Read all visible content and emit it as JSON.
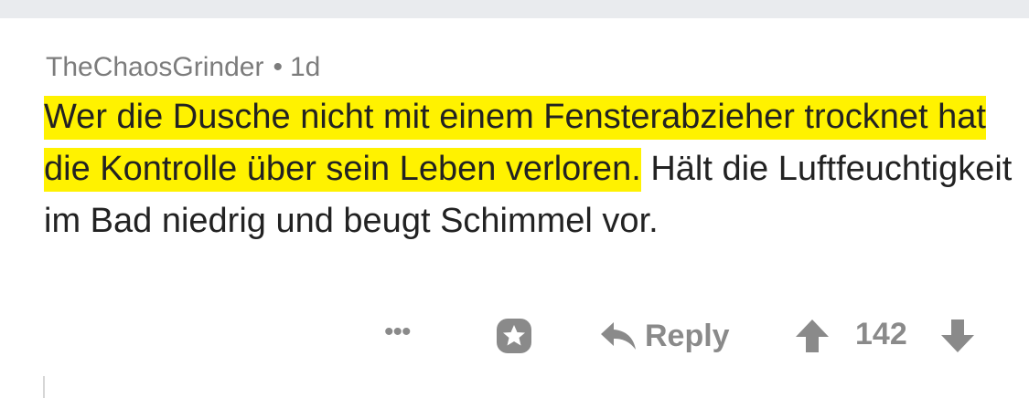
{
  "comment": {
    "author": "TheChaosGrinder",
    "separator": "•",
    "age": "1d",
    "highlighted_text": "Wer die Dusche nicht mit einem Fensterabzieher trocknet hat die Kontrolle über sein Leben verloren.",
    "rest_text": " Hält die Luftfeuchtigkeit im Bad niedrig und beugt Schimmel vor.",
    "highlight_color": "#fff200"
  },
  "actions": {
    "more_label": "•••",
    "award_icon": "award-icon",
    "reply_icon": "reply-arrow-icon",
    "reply_label": "Reply",
    "upvote_icon": "upvote-arrow-icon",
    "score": "142",
    "downvote_icon": "downvote-arrow-icon"
  },
  "colors": {
    "muted_gray": "#8a8a8a",
    "top_band": "#e9ebee",
    "text": "#222222"
  }
}
